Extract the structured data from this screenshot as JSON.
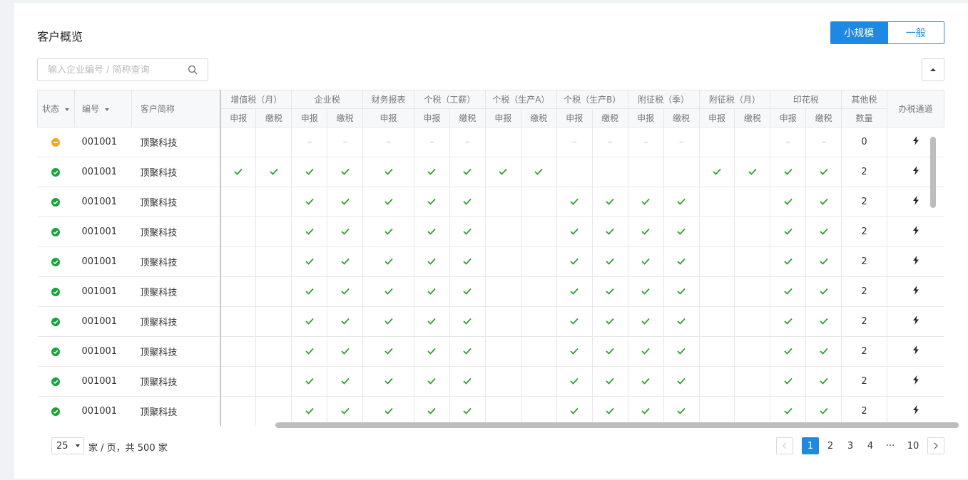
{
  "page_title": "客户概览",
  "toggle": {
    "small": "小规模",
    "general": "一般"
  },
  "search": {
    "placeholder": "输入企业编号 / 简称查询"
  },
  "headers": {
    "status": "状态",
    "code": "编号",
    "name": "客户简称",
    "groups": [
      "增值税（月）",
      "企业税",
      "财务报表",
      "个税（工薪）",
      "个税（生产A）",
      "个税（生产B）",
      "附征税（季）",
      "附征税（月）",
      "印花税",
      "其他税"
    ],
    "declare": "申报",
    "pay": "缴税",
    "count": "数量",
    "channel": "办税通道"
  },
  "rows": [
    {
      "status": "warning",
      "code": "001001",
      "name": "顶聚科技",
      "cells": [
        "",
        "",
        "-",
        "-",
        "-",
        "-",
        "-",
        "",
        "",
        "-",
        "-",
        "-",
        "-",
        "",
        "",
        "-",
        "-"
      ],
      "count": "0"
    },
    {
      "status": "ok",
      "code": "001001",
      "name": "顶聚科技",
      "cells": [
        "✓",
        "✓",
        "✓",
        "✓",
        "✓",
        "✓",
        "✓",
        "✓",
        "✓",
        "",
        "",
        "",
        "",
        "✓",
        "✓",
        "✓",
        "✓"
      ],
      "count": "2"
    },
    {
      "status": "ok",
      "code": "001001",
      "name": "顶聚科技",
      "cells": [
        "",
        "",
        "✓",
        "✓",
        "✓",
        "✓",
        "✓",
        "",
        "",
        "✓",
        "✓",
        "✓",
        "✓",
        "",
        "",
        "✓",
        "✓"
      ],
      "count": "2"
    },
    {
      "status": "ok",
      "code": "001001",
      "name": "顶聚科技",
      "cells": [
        "",
        "",
        "✓",
        "✓",
        "✓",
        "✓",
        "✓",
        "",
        "",
        "✓",
        "✓",
        "✓",
        "✓",
        "",
        "",
        "✓",
        "✓"
      ],
      "count": "2"
    },
    {
      "status": "ok",
      "code": "001001",
      "name": "顶聚科技",
      "cells": [
        "",
        "",
        "✓",
        "✓",
        "✓",
        "✓",
        "✓",
        "",
        "",
        "✓",
        "✓",
        "✓",
        "✓",
        "",
        "",
        "✓",
        "✓"
      ],
      "count": "2"
    },
    {
      "status": "ok",
      "code": "001001",
      "name": "顶聚科技",
      "cells": [
        "",
        "",
        "✓",
        "✓",
        "✓",
        "✓",
        "✓",
        "",
        "",
        "✓",
        "✓",
        "✓",
        "✓",
        "",
        "",
        "✓",
        "✓"
      ],
      "count": "2"
    },
    {
      "status": "ok",
      "code": "001001",
      "name": "顶聚科技",
      "cells": [
        "",
        "",
        "✓",
        "✓",
        "✓",
        "✓",
        "✓",
        "",
        "",
        "✓",
        "✓",
        "✓",
        "✓",
        "",
        "",
        "✓",
        "✓"
      ],
      "count": "2"
    },
    {
      "status": "ok",
      "code": "001001",
      "name": "顶聚科技",
      "cells": [
        "",
        "",
        "✓",
        "✓",
        "✓",
        "✓",
        "✓",
        "",
        "",
        "✓",
        "✓",
        "✓",
        "✓",
        "",
        "",
        "✓",
        "✓"
      ],
      "count": "2"
    },
    {
      "status": "ok",
      "code": "001001",
      "name": "顶聚科技",
      "cells": [
        "",
        "",
        "✓",
        "✓",
        "✓",
        "✓",
        "✓",
        "",
        "",
        "✓",
        "✓",
        "✓",
        "✓",
        "",
        "",
        "✓",
        "✓"
      ],
      "count": "2"
    },
    {
      "status": "ok",
      "code": "001001",
      "name": "顶聚科技",
      "cells": [
        "",
        "",
        "✓",
        "✓",
        "✓",
        "✓",
        "✓",
        "",
        "",
        "✓",
        "✓",
        "✓",
        "✓",
        "",
        "",
        "✓",
        "✓"
      ],
      "count": "2"
    }
  ],
  "pagination": {
    "page_size": "25",
    "total_text": "家 / 页，共 500 家",
    "pages": [
      "1",
      "2",
      "3",
      "4",
      "···",
      "10"
    ],
    "current": "1"
  },
  "colors": {
    "accent": "#1e88e5",
    "ok": "#19a33c",
    "warning": "#f5a623",
    "check": "#2ca02c"
  }
}
